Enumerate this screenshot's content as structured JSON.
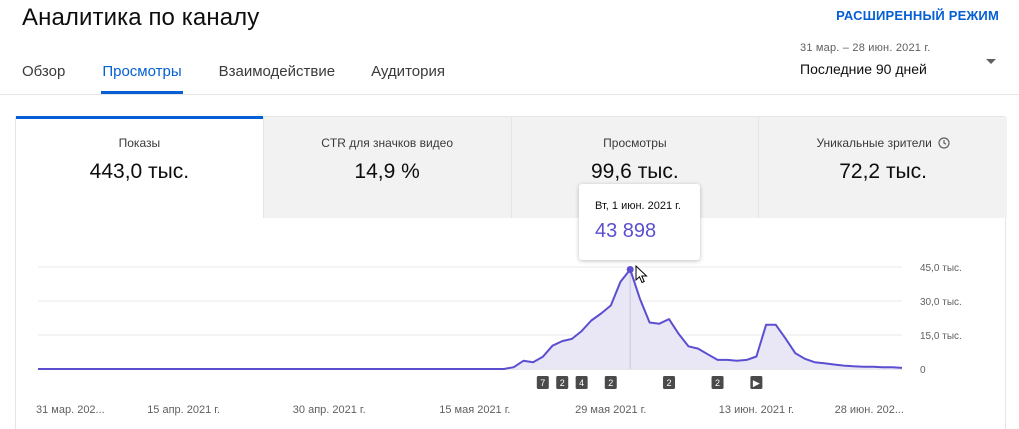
{
  "header": {
    "title": "Аналитика по каналу",
    "advanced_mode": "РАСШИРЕННЫЙ РЕЖИМ"
  },
  "tabs": [
    {
      "label": "Обзор",
      "active": false
    },
    {
      "label": "Просмотры",
      "active": true
    },
    {
      "label": "Взаимодействие",
      "active": false
    },
    {
      "label": "Аудитория",
      "active": false
    }
  ],
  "date_range": {
    "range_text": "31 мар. – 28 июн. 2021 г.",
    "selected": "Последние 90 дней",
    "icon": "chevron-down-icon"
  },
  "metrics": [
    {
      "label": "Показы",
      "value": "443,0 тыс.",
      "active": true
    },
    {
      "label": "CTR для значков видео",
      "value": "14,9 %",
      "active": false
    },
    {
      "label": "Просмотры",
      "value": "99,6 тыс.",
      "active": false
    },
    {
      "label": "Уникальные зрители",
      "value": "72,2 тыс.",
      "active": false,
      "icon": "clock-icon"
    }
  ],
  "tooltip": {
    "date": "Вт, 1 июн. 2021 г.",
    "value": "43 898"
  },
  "colors": {
    "accent": "#065fd4",
    "series": "#5b4fd0",
    "fill": "#e9e7f6"
  },
  "chart_data": {
    "type": "area",
    "ylim": [
      0,
      45000
    ],
    "y_ticks": [
      "45,0 тыс.",
      "30,0 тыс.",
      "15,0 тыс.",
      "0"
    ],
    "y_tick_values": [
      45000,
      30000,
      15000,
      0
    ],
    "x_tick_labels": [
      "31 мар. 202...",
      "15 апр. 2021 г.",
      "30 апр. 2021 г.",
      "15 мая 2021 г.",
      "29 мая 2021 г.",
      "13 июн. 2021 г.",
      "28 июн. 202..."
    ],
    "x_tick_days": [
      0,
      15,
      30,
      45,
      59,
      74,
      89
    ],
    "grid": true,
    "series": [
      {
        "x": [
          0,
          48,
          49,
          50,
          51,
          52,
          53,
          54,
          55,
          56,
          57,
          58,
          59,
          60,
          61,
          62,
          63,
          64,
          65,
          66,
          67,
          68,
          69,
          70,
          71,
          72,
          73,
          74,
          75,
          76,
          77,
          78,
          79,
          80,
          81,
          82,
          83,
          84,
          85,
          86,
          87,
          88,
          89
        ],
        "values": [
          0,
          0,
          800,
          3600,
          3000,
          5400,
          10300,
          12300,
          13300,
          16700,
          21400,
          24500,
          28000,
          38500,
          43898,
          31000,
          20500,
          20000,
          22000,
          15500,
          10000,
          9000,
          6500,
          4000,
          4000,
          3600,
          4000,
          5500,
          19500,
          19500,
          13500,
          7000,
          4500,
          3000,
          2500,
          2000,
          1500,
          1200,
          1000,
          1000,
          800,
          800,
          500
        ]
      }
    ],
    "highlight_day": 61,
    "markers": [
      {
        "label": "7",
        "day": 52
      },
      {
        "label": "2",
        "day": 54
      },
      {
        "label": "4",
        "day": 56
      },
      {
        "label": "2",
        "day": 59
      },
      {
        "label": "2",
        "day": 65
      },
      {
        "label": "2",
        "day": 70
      },
      {
        "label": "▶",
        "day": 74
      }
    ]
  }
}
